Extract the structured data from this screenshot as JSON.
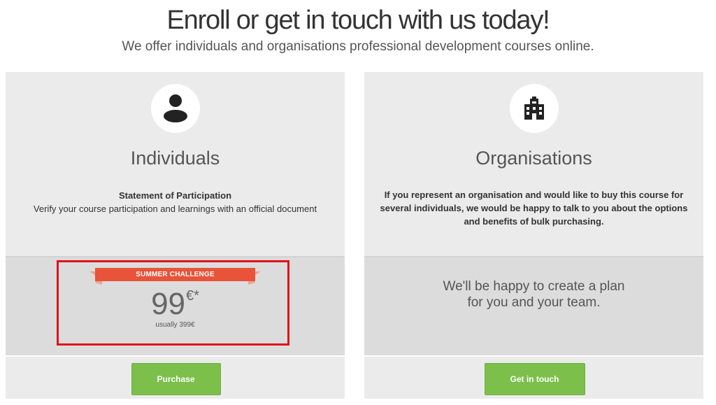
{
  "header": {
    "title": "Enroll or get in touch with us today!",
    "subtitle": "We offer individuals and organisations professional development courses online."
  },
  "individuals": {
    "icon": "person-icon",
    "title": "Individuals",
    "description_heading": "Statement of Participation",
    "description": "Verify your course participation and learnings with an official document",
    "ribbon_label": "SUMMER CHALLENGE",
    "price": "99",
    "currency": "€*",
    "usual_price": "usually 399€",
    "button_label": "Purchase"
  },
  "organisations": {
    "icon": "building-icon",
    "title": "Organisations",
    "description": "If you represent an organisation and would like to buy this course for several individuals, we would be happy to talk to you about the options and benefits of bulk purchasing.",
    "plan_text": "We'll be happy to create a plan for you and your team.",
    "button_label": "Get in touch"
  },
  "colors": {
    "accent_green": "#7cbf4b",
    "ribbon_red": "#e8533a",
    "highlight_red": "#e0121b"
  }
}
